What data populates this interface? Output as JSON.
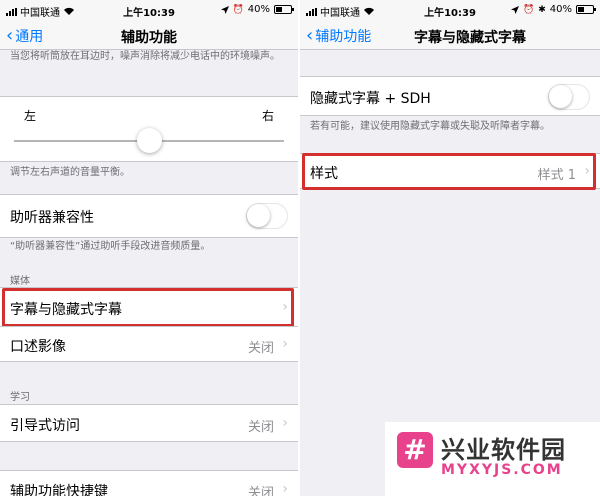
{
  "left": {
    "status": {
      "carrier": "中国联通",
      "time": "上午10:39",
      "battery": "40%"
    },
    "nav": {
      "back": "通用",
      "title": "辅助功能"
    },
    "top_note": "当您将听筒放在耳边时，噪声消除将减少电话中的环境噪声。",
    "balance": {
      "left": "左",
      "right": "右",
      "position": 0.5
    },
    "balance_note": "调节左右声道的音量平衡。",
    "hearing_aid": {
      "label": "助听器兼容性",
      "on": false
    },
    "hearing_note": "“助听器兼容性”通过助听手段改进音频质量。",
    "media_header": "媒体",
    "subtitles": {
      "label": "字幕与隐藏式字幕"
    },
    "audio_desc": {
      "label": "口述影像",
      "value": "关闭"
    },
    "learning_header": "学习",
    "guided_access": {
      "label": "引导式访问",
      "value": "关闭"
    },
    "shortcut": {
      "label": "辅助功能快捷键",
      "value": "关闭"
    }
  },
  "right": {
    "status": {
      "carrier": "中国联通",
      "time": "上午10:39",
      "battery": "40%"
    },
    "nav": {
      "back": "辅助功能",
      "title": "字幕与隐藏式字幕"
    },
    "cc": {
      "label": "隐藏式字幕 + SDH",
      "on": false
    },
    "cc_note": "若有可能，建议使用隐藏式字幕或失聪及听障者字幕。",
    "style": {
      "label": "样式",
      "value": "样式 1"
    }
  },
  "watermark": {
    "title": "兴业软件园",
    "subtitle": "MYXYJS.COM",
    "logo_char": "#"
  },
  "colors": {
    "ios_blue": "#007aff",
    "highlight_red": "#d32f2f",
    "group_bg": "#efeff4",
    "brand_pink": "#e8428c"
  },
  "icons": [
    "chevron-left-icon",
    "chevron-right-icon",
    "wifi-icon",
    "signal-icon",
    "battery-icon",
    "alarm-icon",
    "bluetooth-icon",
    "location-icon"
  ]
}
